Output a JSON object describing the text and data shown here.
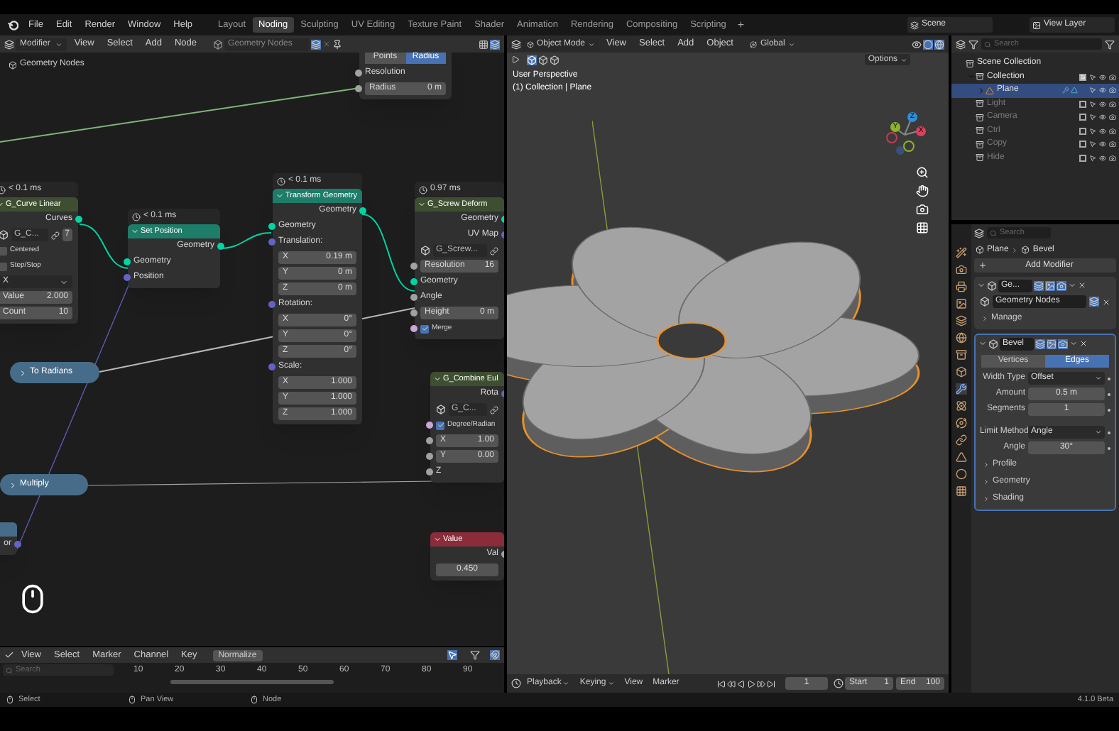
{
  "menus": [
    "File",
    "Edit",
    "Render",
    "Window",
    "Help"
  ],
  "workspaces": [
    {
      "label": "Layout",
      "selected": false
    },
    {
      "label": "Noding",
      "selected": true
    },
    {
      "label": "Sculpting",
      "selected": false
    },
    {
      "label": "UV Editing",
      "selected": false
    },
    {
      "label": "Texture Paint",
      "selected": false
    },
    {
      "label": "Shader",
      "selected": false
    },
    {
      "label": "Animation",
      "selected": false
    },
    {
      "label": "Rendering",
      "selected": false
    },
    {
      "label": "Compositing",
      "selected": false
    },
    {
      "label": "Scripting",
      "selected": false
    }
  ],
  "add_workspace": "+",
  "scene": "Scene",
  "view_layer": "View Layer",
  "node_editor": {
    "mode": "Modifier",
    "menus": [
      "View",
      "Select",
      "Add",
      "Node"
    ],
    "node_tree": "Geometry Nodes",
    "breadcrumb": "Geometry Nodes",
    "nodes": [
      {
        "kind": "node",
        "rows": [
          {
            "kind": "toggle",
            "options": [
              {
                "label": "Points",
                "selected": false
              },
              {
                "label": "Radius",
                "selected": true
              }
            ]
          },
          {
            "kind": "input",
            "label": "Resolution",
            "color": "#a1a1a1"
          },
          {
            "kind": "field",
            "label": "Radius",
            "value": "0 m",
            "color": "#a1a1a1"
          }
        ]
      },
      {
        "kind": "node",
        "timing": "< 0.1 ms",
        "title": "G_Curve Linear",
        "color": "#3d4f30",
        "rows": [
          {
            "kind": "output",
            "label": "Curves",
            "color": "#00d6a3"
          },
          {
            "kind": "selector",
            "value": "G_C...",
            "count": "7"
          },
          {
            "kind": "checkbox",
            "label": "Centered",
            "checked": false
          },
          {
            "kind": "checkbox",
            "label": "Step/Stop",
            "checked": false
          },
          {
            "kind": "dropdown",
            "value": "X"
          },
          {
            "kind": "field",
            "label": "Value",
            "value": "2.000"
          },
          {
            "kind": "field",
            "label": "Count",
            "value": "10"
          }
        ]
      },
      {
        "kind": "node",
        "timing": "< 0.1 ms",
        "title": "Set Position",
        "color": "#1d7d69",
        "rows": [
          {
            "kind": "output",
            "label": "Geometry",
            "color": "#00d6a3"
          },
          {
            "kind": "input",
            "label": "Geometry",
            "color": "#00d6a3"
          },
          {
            "kind": "input",
            "label": "Position",
            "color": "#6363c7"
          }
        ]
      },
      {
        "kind": "node",
        "timing": "< 0.1 ms",
        "title": "Transform Geometry",
        "color": "#1d7d69",
        "rows": [
          {
            "kind": "output",
            "label": "Geometry",
            "color": "#00d6a3"
          },
          {
            "kind": "input",
            "label": "Geometry",
            "color": "#00d6a3"
          },
          {
            "kind": "input",
            "label": "Translation:",
            "color": "#6363c7"
          },
          {
            "kind": "field",
            "label": "X",
            "value": "0.19 m"
          },
          {
            "kind": "field",
            "label": "Y",
            "value": "0 m"
          },
          {
            "kind": "field",
            "label": "Z",
            "value": "0 m"
          },
          {
            "kind": "input",
            "label": "Rotation:",
            "color": "#6363c7"
          },
          {
            "kind": "field",
            "label": "X",
            "value": "0°"
          },
          {
            "kind": "field",
            "label": "Y",
            "value": "0°"
          },
          {
            "kind": "field",
            "label": "Z",
            "value": "0°"
          },
          {
            "kind": "input",
            "label": "Scale:",
            "color": "#6363c7"
          },
          {
            "kind": "field",
            "label": "X",
            "value": "1.000"
          },
          {
            "kind": "field",
            "label": "Y",
            "value": "1.000"
          },
          {
            "kind": "field",
            "label": "Z",
            "value": "1.000"
          }
        ]
      },
      {
        "kind": "node",
        "timing": "0.97 ms",
        "title": "G_Screw Deform",
        "color": "#3d4f30",
        "rows": [
          {
            "kind": "output",
            "label": "Geometry",
            "color": "#00d6a3"
          },
          {
            "kind": "output",
            "label": "UV Map",
            "color": "#6363c7"
          },
          {
            "kind": "selector",
            "value": "G_Screw..."
          },
          {
            "kind": "field",
            "label": "Resolution",
            "value": "16",
            "color": "#a1a1a1"
          },
          {
            "kind": "input",
            "label": "Geometry",
            "color": "#00d6a3"
          },
          {
            "kind": "input",
            "label": "Angle",
            "color": "#a1a1a1"
          },
          {
            "kind": "field",
            "label": "Height",
            "value": "0 m",
            "color": "#a1a1a1"
          },
          {
            "kind": "checkbox",
            "label": "Merge",
            "checked": true,
            "color": "#cca6d6"
          }
        ]
      },
      {
        "kind": "node",
        "title": "G_Combine Eul",
        "color": "#3d4f30",
        "rows": [
          {
            "kind": "output",
            "label": "Rota",
            "color": "#6363c7"
          },
          {
            "kind": "selector",
            "value": "G_C..."
          },
          {
            "kind": "checkbox",
            "label": "Degree/Radian",
            "checked": true,
            "color": "#cca6d6"
          },
          {
            "kind": "field",
            "label": "X",
            "value": "1.00",
            "color": "#a1a1a1"
          },
          {
            "kind": "field",
            "label": "Y",
            "value": "0.00",
            "color": "#a1a1a1"
          },
          {
            "kind": "input",
            "label": "Z",
            "color": "#a1a1a1"
          }
        ]
      },
      {
        "kind": "node",
        "title": "Value",
        "color": "#8a2c39",
        "rows": [
          {
            "kind": "output",
            "label": "Val",
            "color": "#a1a1a1"
          },
          {
            "kind": "field",
            "value": "0.450"
          }
        ]
      },
      {
        "kind": "collapsed",
        "label": "To Radians",
        "color": "#466c89"
      },
      {
        "kind": "collapsed",
        "label": "Multiply",
        "color": "#466c89"
      },
      {
        "kind": "node",
        "color": "#466c89",
        "rows": [
          {
            "kind": "output",
            "label": "or",
            "color": "#6363c7"
          }
        ]
      }
    ]
  },
  "timeline": {
    "menus": [
      "View",
      "Select",
      "Marker",
      "Channel",
      "Key"
    ],
    "normalize": "Normalize",
    "search": {
      "placeholder": "Search"
    },
    "ticks": [
      "10",
      "20",
      "30",
      "40",
      "50",
      "60",
      "70",
      "80",
      "90"
    ]
  },
  "viewport": {
    "mode": "Object Mode",
    "menus": [
      "View",
      "Select",
      "Add",
      "Object"
    ],
    "orientation": "Global",
    "options": "Options",
    "overlay_lines": [
      "User Perspective",
      "(1) Collection | Plane"
    ],
    "gizmo_axes": [
      "Z",
      "Y",
      "X"
    ]
  },
  "playback_bar": {
    "menus": [
      "Playback",
      "Keying",
      "View",
      "Marker"
    ],
    "current_frame": "1",
    "start_label": "Start",
    "start": "1",
    "end_label": "End",
    "end": "100"
  },
  "outliner": {
    "search": {
      "placeholder": "Search"
    },
    "tree": [
      {
        "label": "Scene Collection",
        "kind": "scene",
        "selected": false,
        "children": [
          {
            "label": "Collection",
            "kind": "collection",
            "checked": true,
            "expanded": true,
            "selected": false,
            "children": [
              {
                "label": "Plane",
                "kind": "object",
                "expanded": false,
                "selected": true
              }
            ]
          },
          {
            "label": "Light",
            "kind": "collection",
            "checked": false,
            "selected": false
          },
          {
            "label": "Camera",
            "kind": "collection",
            "checked": false,
            "selected": false
          },
          {
            "label": "Ctrl",
            "kind": "collection",
            "checked": false,
            "selected": false
          },
          {
            "label": "Copy",
            "kind": "collection",
            "checked": false,
            "selected": false
          },
          {
            "label": "Hide",
            "kind": "collection",
            "checked": false,
            "selected": false
          }
        ]
      }
    ]
  },
  "properties": {
    "search": {
      "placeholder": "Search"
    },
    "breadcrumb": [
      "Plane",
      "Bevel"
    ],
    "add_modifier": "Add Modifier",
    "tabs": [
      {
        "kind": "tool",
        "selected": false
      },
      {
        "kind": "render",
        "selected": false
      },
      {
        "kind": "output",
        "selected": false
      },
      {
        "kind": "view",
        "selected": false
      },
      {
        "kind": "scene",
        "selected": false
      },
      {
        "kind": "world",
        "selected": false
      },
      {
        "kind": "collection",
        "selected": false
      },
      {
        "kind": "object",
        "selected": false
      },
      {
        "kind": "modifiers",
        "selected": true
      },
      {
        "kind": "particles",
        "selected": false
      },
      {
        "kind": "physics",
        "selected": false
      },
      {
        "kind": "constraints",
        "selected": false
      },
      {
        "kind": "data",
        "selected": false
      },
      {
        "kind": "material",
        "selected": false
      },
      {
        "kind": "texture",
        "selected": false
      }
    ],
    "modifiers": [
      {
        "kind": "nodes",
        "name": "Ge...",
        "expanded": true,
        "node_group": "Geometry Nodes",
        "sections": [
          {
            "label": "Manage",
            "expanded": false
          }
        ]
      },
      {
        "kind": "bevel",
        "name": "Bevel",
        "expanded": true,
        "tabs": [
          {
            "label": "Vertices",
            "selected": false
          },
          {
            "label": "Edges",
            "selected": true
          }
        ],
        "fields": [
          {
            "kind": "dropdown",
            "label": "Width Type",
            "value": "Offset"
          },
          {
            "kind": "number",
            "label": "Amount",
            "value": "0.5 m"
          },
          {
            "kind": "number",
            "label": "Segments",
            "value": "1"
          },
          {
            "kind": "dropdown",
            "label": "Limit Method",
            "value": "Angle"
          },
          {
            "kind": "number",
            "label": "Angle",
            "value": "30°"
          }
        ],
        "sections": [
          {
            "label": "Profile",
            "expanded": false
          },
          {
            "label": "Geometry",
            "expanded": false
          },
          {
            "label": "Shading",
            "expanded": false
          }
        ]
      }
    ]
  },
  "status_bar": {
    "hints": [
      "Select",
      "Pan View",
      "Node"
    ],
    "version": "4.1.0 Beta"
  }
}
